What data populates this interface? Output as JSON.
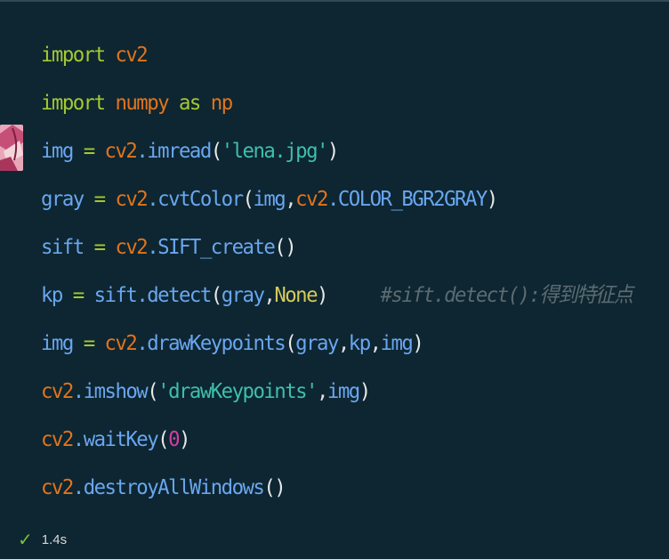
{
  "code_lines": [
    [
      {
        "t": "import",
        "c": "kw"
      },
      {
        "t": " ",
        "c": "punc"
      },
      {
        "t": "cv2",
        "c": "mod"
      }
    ],
    [
      {
        "t": "import",
        "c": "kw"
      },
      {
        "t": " ",
        "c": "punc"
      },
      {
        "t": "numpy",
        "c": "mod"
      },
      {
        "t": " ",
        "c": "punc"
      },
      {
        "t": "as",
        "c": "kw"
      },
      {
        "t": " ",
        "c": "punc"
      },
      {
        "t": "np",
        "c": "mod"
      }
    ],
    [
      {
        "t": "img",
        "c": "var"
      },
      {
        "t": " = ",
        "c": "op"
      },
      {
        "t": "cv2",
        "c": "mod"
      },
      {
        "t": ".imread",
        "c": "fn"
      },
      {
        "t": "(",
        "c": "paren"
      },
      {
        "t": "'lena.jpg'",
        "c": "str"
      },
      {
        "t": ")",
        "c": "paren"
      }
    ],
    [
      {
        "t": "gray",
        "c": "var"
      },
      {
        "t": " = ",
        "c": "op"
      },
      {
        "t": "cv2",
        "c": "mod"
      },
      {
        "t": ".cvtColor",
        "c": "fn"
      },
      {
        "t": "(",
        "c": "paren"
      },
      {
        "t": "img",
        "c": "var"
      },
      {
        "t": ",",
        "c": "punc"
      },
      {
        "t": "cv2",
        "c": "mod"
      },
      {
        "t": ".COLOR_BGR2GRAY",
        "c": "fn"
      },
      {
        "t": ")",
        "c": "paren"
      }
    ],
    [
      {
        "t": "sift",
        "c": "var"
      },
      {
        "t": " = ",
        "c": "op"
      },
      {
        "t": "cv2",
        "c": "mod"
      },
      {
        "t": ".SIFT_create",
        "c": "fn"
      },
      {
        "t": "()",
        "c": "paren"
      }
    ],
    [
      {
        "t": "kp",
        "c": "var"
      },
      {
        "t": " = ",
        "c": "op"
      },
      {
        "t": "sift",
        "c": "var"
      },
      {
        "t": ".detect",
        "c": "fn"
      },
      {
        "t": "(",
        "c": "paren"
      },
      {
        "t": "gray",
        "c": "var"
      },
      {
        "t": ",",
        "c": "punc"
      },
      {
        "t": "None",
        "c": "const"
      },
      {
        "t": ")",
        "c": "paren"
      },
      {
        "t": "     ",
        "c": "punc"
      },
      {
        "t": "#sift.detect():得到特征点",
        "c": "cmt"
      }
    ],
    [
      {
        "t": "img",
        "c": "var"
      },
      {
        "t": " = ",
        "c": "op"
      },
      {
        "t": "cv2",
        "c": "mod"
      },
      {
        "t": ".drawKeypoints",
        "c": "fn"
      },
      {
        "t": "(",
        "c": "paren"
      },
      {
        "t": "gray",
        "c": "var"
      },
      {
        "t": ",",
        "c": "punc"
      },
      {
        "t": "kp",
        "c": "var"
      },
      {
        "t": ",",
        "c": "punc"
      },
      {
        "t": "img",
        "c": "var"
      },
      {
        "t": ")",
        "c": "paren"
      }
    ],
    [
      {
        "t": "cv2",
        "c": "mod"
      },
      {
        "t": ".imshow",
        "c": "fn"
      },
      {
        "t": "(",
        "c": "paren"
      },
      {
        "t": "'drawKeypoints'",
        "c": "str"
      },
      {
        "t": ",",
        "c": "punc"
      },
      {
        "t": "img",
        "c": "var"
      },
      {
        "t": ")",
        "c": "paren"
      }
    ],
    [
      {
        "t": "cv2",
        "c": "mod"
      },
      {
        "t": ".waitKey",
        "c": "fn"
      },
      {
        "t": "(",
        "c": "paren"
      },
      {
        "t": "0",
        "c": "num"
      },
      {
        "t": ")",
        "c": "paren"
      }
    ],
    [
      {
        "t": "cv2",
        "c": "mod"
      },
      {
        "t": ".destroyAllWindows",
        "c": "fn"
      },
      {
        "t": "()",
        "c": "paren"
      }
    ]
  ],
  "status": {
    "check": "✓",
    "duration": "1.4s"
  },
  "colors": {
    "background": "#0d2631",
    "keyword": "#a6c832",
    "module": "#e3741c",
    "variable": "#6aa6f0",
    "string": "#3fbfaa",
    "number": "#d63ca8",
    "comment": "#5b6b72",
    "success": "#7bbf3a"
  }
}
